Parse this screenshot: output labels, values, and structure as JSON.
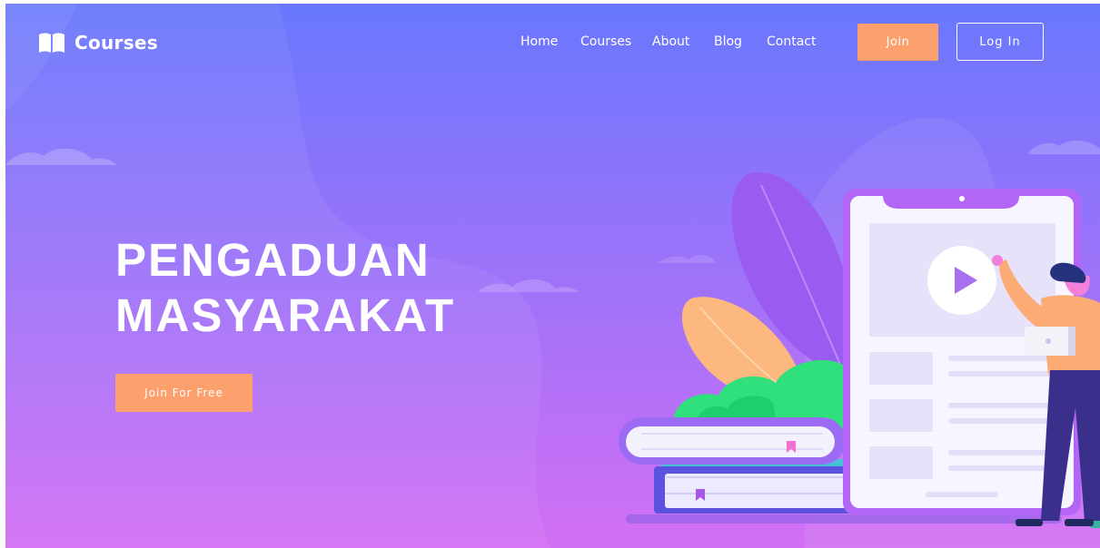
{
  "brand": {
    "logo_icon": "open-book-icon",
    "name": "Courses"
  },
  "nav": {
    "links": [
      "Home",
      "Courses",
      "About",
      "Blog",
      "Contact"
    ],
    "join_label": "Join",
    "login_label": "Log In"
  },
  "hero": {
    "title_line1": "PENGADUAN",
    "title_line2": "MASYARAKAT",
    "cta_label": "Join For Free"
  },
  "illustration": {
    "icons": [
      "play-icon",
      "bookmark-icon",
      "laptop-icon"
    ]
  },
  "colors": {
    "gradient_top": "#6878fd",
    "gradient_bottom": "#d36ff4",
    "accent": "#fca06e",
    "text": "#ffffff"
  }
}
